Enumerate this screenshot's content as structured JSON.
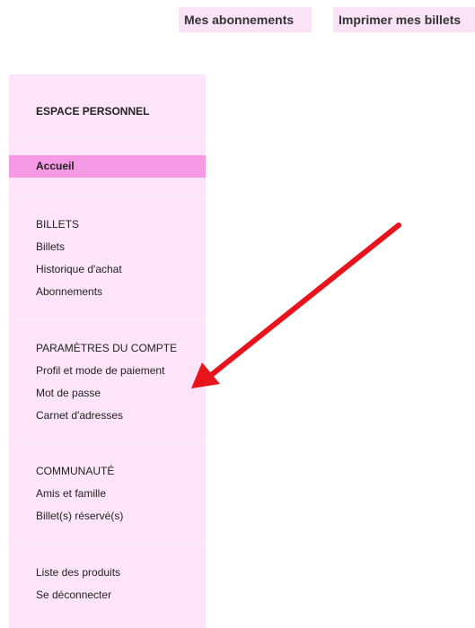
{
  "top_buttons": {
    "subscriptions": "Mes abonnements",
    "print_tickets": "Imprimer mes billets"
  },
  "sidebar": {
    "header": "ESPACE PERSONNEL",
    "active_item": "Accueil",
    "groups": [
      {
        "title": "BILLETS",
        "items": [
          "Billets",
          "Historique d'achat",
          "Abonnements"
        ]
      },
      {
        "title": "PARAMÈTRES DU COMPTE",
        "items": [
          "Profil et mode de paiement",
          "Mot de passe",
          "Carnet d'adresses"
        ]
      },
      {
        "title": "COMMUNAUTÉ",
        "items": [
          "Amis et famille",
          "Billet(s) réservé(s)"
        ]
      },
      {
        "title": "",
        "items": [
          "Liste des produits",
          "Se déconnecter"
        ]
      }
    ]
  },
  "colors": {
    "sidebar_bg": "#fde4f8",
    "active_bg": "#f59be5",
    "top_button_bg": "#fbe3f7",
    "annotation_arrow": "#e8141b"
  },
  "annotation": {
    "icon": "red-arrow-icon"
  }
}
